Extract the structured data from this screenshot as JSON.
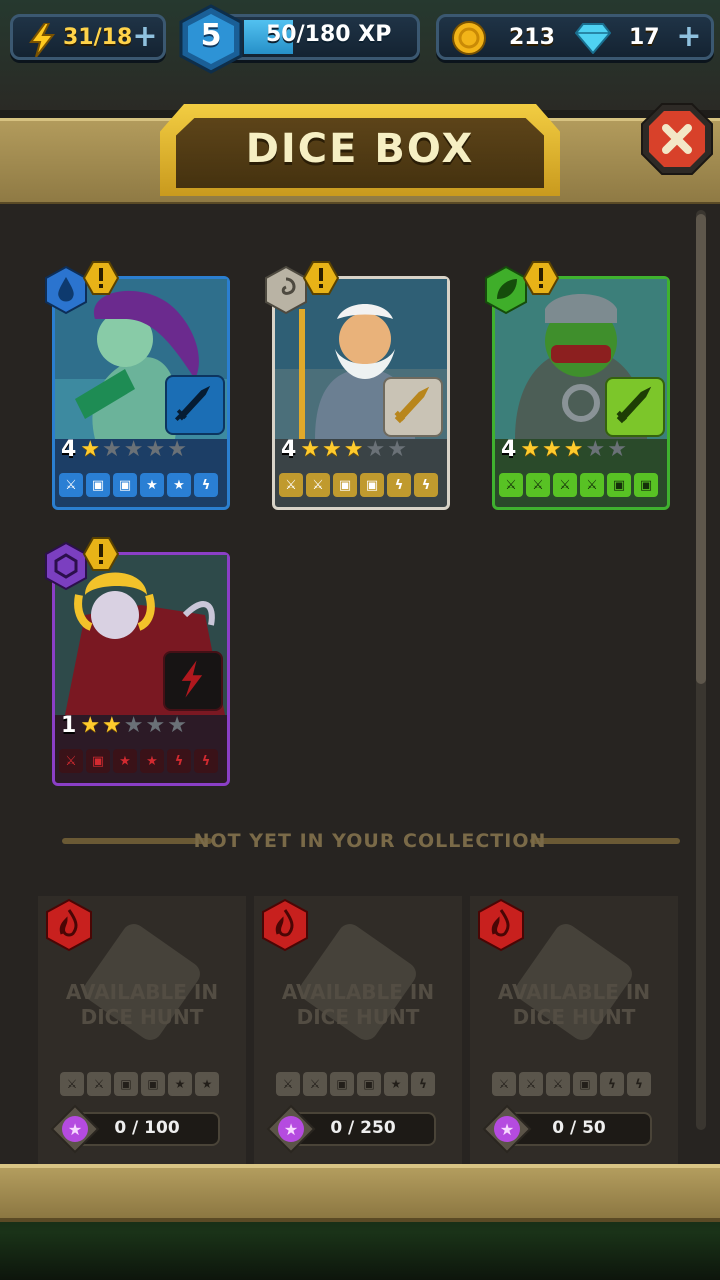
{
  "topbar": {
    "energy": "31/18",
    "level": "5",
    "xp": "50/180 XP",
    "xp_progress": 0.28,
    "coins": "213",
    "gems": "17"
  },
  "header": {
    "title": "DICE BOX"
  },
  "cards": [
    {
      "level": "4",
      "stars": 1,
      "element": "water",
      "border": "#2b7fd0",
      "faces": [
        "sword",
        "shield",
        "shield",
        "star",
        "star",
        "bolt"
      ],
      "face_color": "#2a7fd4"
    },
    {
      "level": "4",
      "stars": 3,
      "element": "wind",
      "border": "#d8d3c8",
      "faces": [
        "sword",
        "sword",
        "shield",
        "shield",
        "bolt",
        "bolt"
      ],
      "face_color": "#c09a2e"
    },
    {
      "level": "4",
      "stars": 3,
      "element": "nature",
      "border": "#3fb22f",
      "faces": [
        "sword",
        "sword",
        "sword",
        "sword",
        "shield",
        "shield"
      ],
      "face_color": "#58c224"
    },
    {
      "level": "1",
      "stars": 2,
      "element": "void",
      "border": "#8b3fc7",
      "faces": [
        "sword",
        "shield",
        "star",
        "star",
        "bolt",
        "bolt"
      ],
      "face_color": "#c3232a"
    }
  ],
  "collection_divider": "NOT YET IN YOUR COLLECTION",
  "locked": [
    {
      "text_line1": "AVAILABLE IN",
      "text_line2": "DICE HUNT",
      "shards": "0 / 100",
      "faces": [
        "sword",
        "sword",
        "shield",
        "shield",
        "star",
        "star"
      ]
    },
    {
      "text_line1": "AVAILABLE IN",
      "text_line2": "DICE HUNT",
      "shards": "0 / 250",
      "faces": [
        "sword",
        "sword",
        "shield",
        "shield",
        "star",
        "bolt"
      ]
    },
    {
      "text_line1": "AVAILABLE IN",
      "text_line2": "DICE HUNT",
      "shards": "0 / 50",
      "faces": [
        "sword",
        "sword",
        "sword",
        "shield",
        "bolt",
        "bolt"
      ]
    }
  ],
  "colors": {
    "accent": "#ffd34a",
    "panel": "#272421",
    "wood": "#b29b5c"
  },
  "icons": [
    "lightning-bolt-icon",
    "plus-icon",
    "level-hex-icon",
    "coin-icon",
    "diamond-icon",
    "close-x-icon",
    "star-icon",
    "sword-icon",
    "shield-icon",
    "bolt-icon",
    "fire-element-icon",
    "shard-icon"
  ]
}
